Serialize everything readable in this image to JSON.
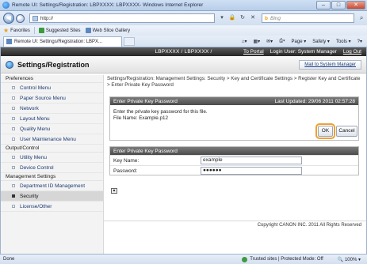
{
  "window": {
    "title": "Remote UI: Settings/Registration: LBPXXXX: LBPXXXX- Windows Internet Explorer"
  },
  "addressbar": {
    "url": "http://",
    "search_placeholder": "Bing",
    "search_brand": "b"
  },
  "favorites": {
    "label": "Favorites",
    "items": [
      "Suggested Sites",
      "Web Slice Gallery"
    ]
  },
  "tab": {
    "label": "Remote UI: Settings/Registration: LBPX..."
  },
  "commandbar": {
    "page": "Page",
    "safety": "Safety",
    "tools": "Tools"
  },
  "topband": {
    "device": "LBPXXXX / LBPXXXX /",
    "portal": "To Portal",
    "login": "Login User: System Manager",
    "logout": "Log Out"
  },
  "header": {
    "title": "Settings/Registration",
    "mail_button": "Mail to System Manager"
  },
  "sidebar": {
    "preferences": "Preferences",
    "pref_items": [
      "Control Menu",
      "Paper Source Menu",
      "Network",
      "Layout Menu",
      "Quality Menu",
      "User Maintenance Menu"
    ],
    "output": "Output/Control",
    "output_items": [
      "Utility Menu",
      "Device Control"
    ],
    "management": "Management Settings",
    "management_items": [
      "Department ID Management",
      "Security",
      "License/Other"
    ]
  },
  "breadcrumb": "Settings/Registration: Management Settings: Security > Key and Certificate Settings > Register Key and Certificate > Enter Private Key Password",
  "dialog": {
    "title": "Enter Private Key Password",
    "last_updated": "Last Updated: 29/06 2011 02:57:28",
    "message": "Enter the private key password for this file.",
    "file_name": "File Name: Example.p12",
    "ok": "OK",
    "cancel": "Cancel"
  },
  "form": {
    "title": "Enter Private Key Password",
    "key_name_label": "Key Name:",
    "key_name_value": "example",
    "password_label": "Password:",
    "password_value": "●●●●●●"
  },
  "footer": "Copyright CANON INC. 2011 All Rights Reserved",
  "status": {
    "done": "Done",
    "zone": "Trusted sites | Protected Mode: Off",
    "zoom": "100%"
  }
}
